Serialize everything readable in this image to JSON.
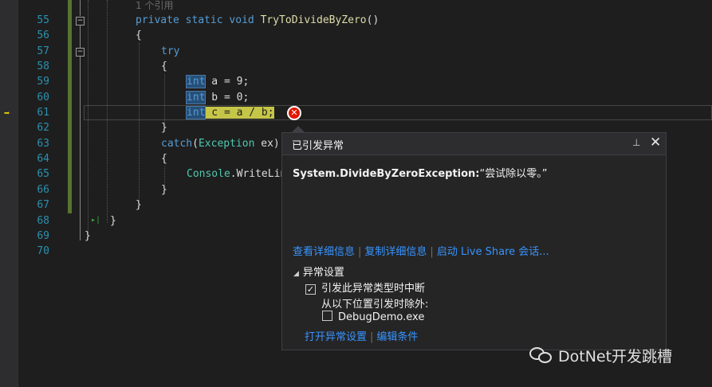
{
  "editor": {
    "line_numbers": [
      "55",
      "56",
      "57",
      "58",
      "59",
      "60",
      "61",
      "62",
      "63",
      "64",
      "65",
      "66",
      "67",
      "68",
      "69",
      "70"
    ],
    "reference_hint": "1 个引用",
    "code": {
      "l55_kw1": "private",
      "l55_kw2": "static",
      "l55_kw3": "void",
      "l55_fn": "TryToDivideByZero",
      "l55_rest": "()",
      "l56": "{",
      "l57_kw": "try",
      "l58": "{",
      "l59_int": "int",
      "l59_rest": " a = 9;",
      "l60_int": "int",
      "l60_rest": " b = 0;",
      "l61_int": "int",
      "l61_rest": " c = a / b;",
      "l62": "}",
      "l63_kw": "catch",
      "l63_open": "(",
      "l63_ty": "Exception",
      "l63_rest": " ex)",
      "l64": "{",
      "l65_ty": "Console",
      "l65_rest": ".WriteLin",
      "l66": "}",
      "l67": "}",
      "l68": "}",
      "l69": "}"
    },
    "error_glyph": "✕"
  },
  "exception_popup": {
    "title": "已引发异常",
    "pin_icon": "pin-icon",
    "close_icon": "close-icon",
    "close_glyph": "✕",
    "pin_glyph": "⊥",
    "exception_type": "System.DivideByZeroException:",
    "exception_message": "“尝试除以零。”",
    "links": {
      "view_details": "查看详细信息",
      "copy_details": "复制详细信息",
      "live_share": "启动 Live Share 会话..."
    },
    "separator": "|",
    "exception_settings": {
      "header": "异常设置",
      "break_when_thrown": {
        "label": "引发此异常类型时中断",
        "checked": true
      },
      "except_when_from": "从以下位置引发时除外:",
      "module": {
        "label": "DebugDemo.exe",
        "checked": false
      }
    },
    "bottom_links": {
      "open_settings": "打开异常设置",
      "edit_conditions": "编辑条件"
    }
  },
  "watermark": {
    "text": "DotNet开发跳槽"
  },
  "colors": {
    "background": "#1e1e1e",
    "line_number": "#2b91af",
    "keyword": "#569cd6",
    "type": "#4ec9b0",
    "method": "#dcdcaa",
    "link": "#3794ff",
    "error": "#e51400"
  }
}
